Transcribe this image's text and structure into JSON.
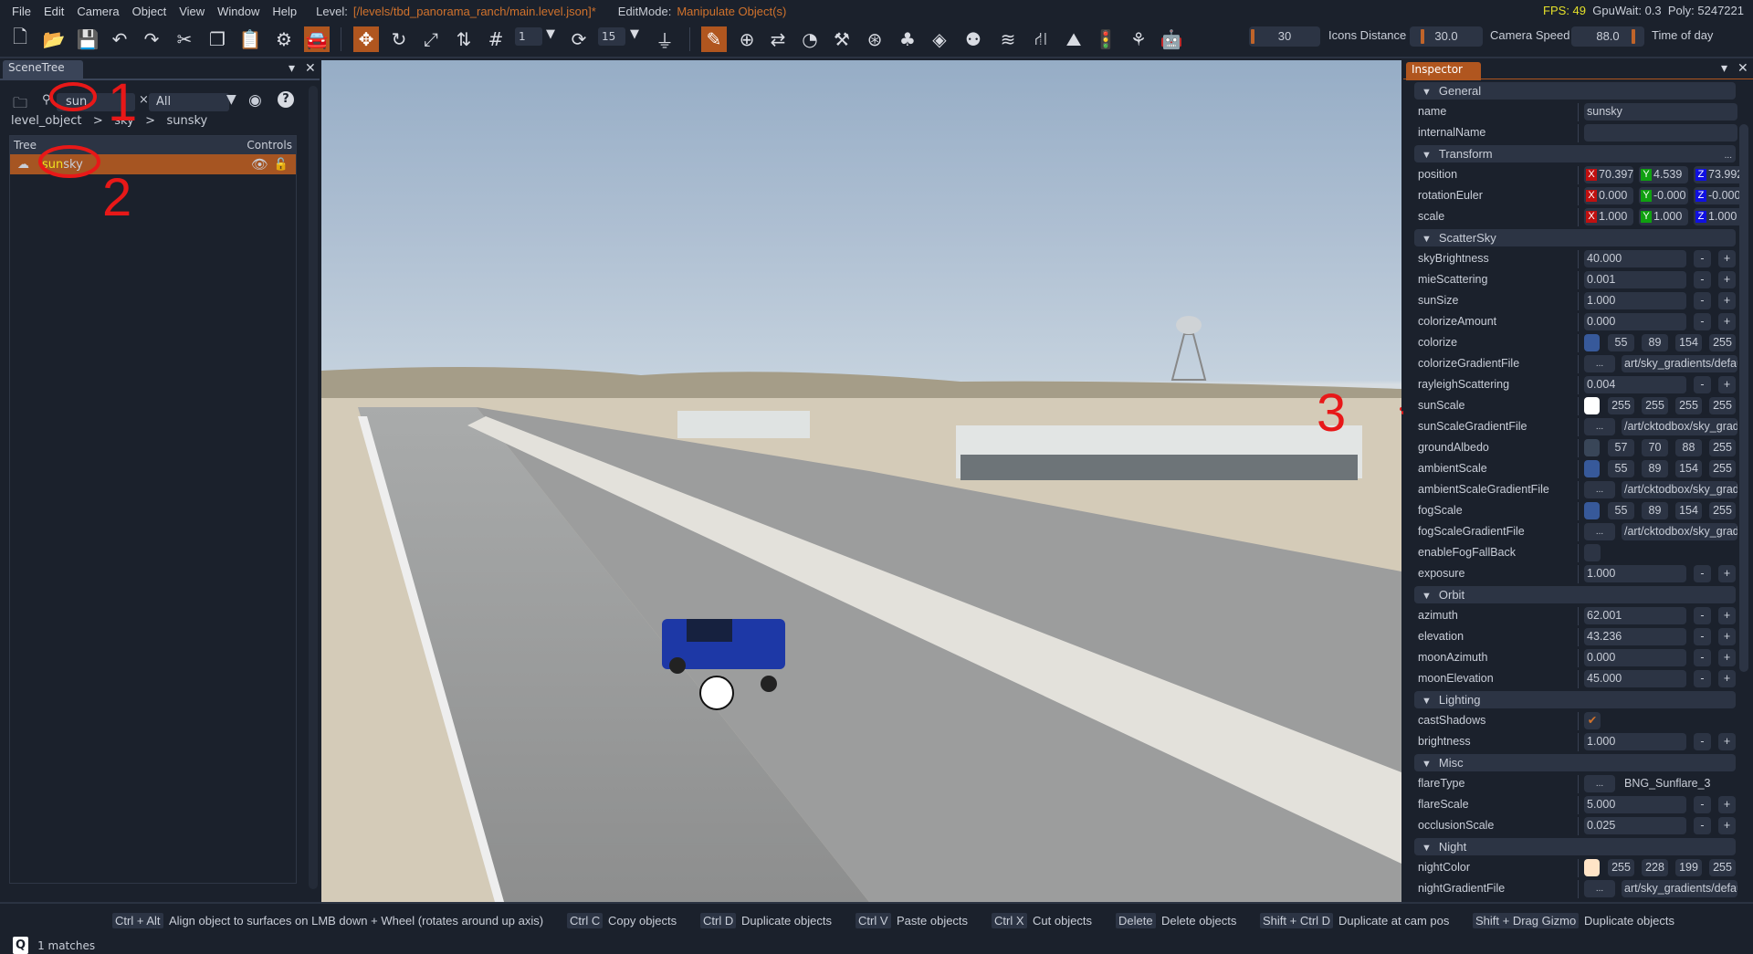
{
  "menu": {
    "items": [
      "File",
      "Edit",
      "Camera",
      "Object",
      "View",
      "Window",
      "Help"
    ],
    "level_label": "Level:",
    "level_value": "[/levels/tbd_panorama_ranch/main.level.json]*",
    "editmode_label": "EditMode:",
    "editmode_value": "Manipulate Object(s)"
  },
  "perf": {
    "fps": "FPS: 49",
    "gpu": "GpuWait: 0.3",
    "poly": "Poly: 5247221"
  },
  "toolbar": {
    "grid_value": "1",
    "rot_snap_value": "15",
    "icons_distance_value": "30",
    "icons_distance_label": "Icons Distance",
    "camera_speed_value": "30.0",
    "camera_speed_label": "Camera Speed",
    "time_of_day_value": "88.0",
    "time_of_day_label": "Time of day"
  },
  "scenetree": {
    "tab": "SceneTree",
    "search_value": "sun",
    "filter_value": "All",
    "breadcrumb": [
      "level_object",
      ">",
      "sky",
      ">",
      "sunsky"
    ],
    "col_tree": "Tree",
    "col_controls": "Controls",
    "item_match": "sun",
    "item_rest": "sky",
    "matches": "1 matches"
  },
  "inspector": {
    "tab": "Inspector",
    "rows": [
      {
        "t": "sec",
        "label": "General"
      },
      {
        "t": "text",
        "label": "name",
        "value": "sunsky"
      },
      {
        "t": "text",
        "label": "internalName",
        "value": ""
      },
      {
        "t": "sec",
        "label": "Transform",
        "extra": "..."
      },
      {
        "t": "vec3",
        "label": "position",
        "x": "70.397",
        "y": "4.539",
        "z": "73.992"
      },
      {
        "t": "vec3",
        "label": "rotationEuler",
        "x": "0.000",
        "y": "-0.000",
        "z": "-0.000"
      },
      {
        "t": "vec3",
        "label": "scale",
        "x": "1.000",
        "y": "1.000",
        "z": "1.000"
      },
      {
        "t": "sec",
        "label": "ScatterSky"
      },
      {
        "t": "num",
        "label": "skyBrightness",
        "value": "40.000"
      },
      {
        "t": "num",
        "label": "mieScattering",
        "value": "0.001"
      },
      {
        "t": "num",
        "label": "sunSize",
        "value": "1.000"
      },
      {
        "t": "num",
        "label": "colorizeAmount",
        "value": "0.000"
      },
      {
        "t": "color",
        "label": "colorize",
        "rgba": [
          "55",
          "89",
          "154",
          "255"
        ],
        "swatch": "#37599a"
      },
      {
        "t": "file",
        "label": "colorizeGradientFile",
        "value": "art/sky_gradients/default"
      },
      {
        "t": "num",
        "label": "rayleighScattering",
        "value": "0.004"
      },
      {
        "t": "color",
        "label": "sunScale",
        "rgba": [
          "255",
          "255",
          "255",
          "255"
        ],
        "swatch": "#ffffff"
      },
      {
        "t": "file",
        "label": "sunScaleGradientFile",
        "value": "/art/cktodbox/sky_gradients"
      },
      {
        "t": "color",
        "label": "groundAlbedo",
        "rgba": [
          "57",
          "70",
          "88",
          "255"
        ],
        "swatch": "#394658"
      },
      {
        "t": "color",
        "label": "ambientScale",
        "rgba": [
          "55",
          "89",
          "154",
          "255"
        ],
        "swatch": "#37599a"
      },
      {
        "t": "file",
        "label": "ambientScaleGradientFile",
        "value": "/art/cktodbox/sky_gradients"
      },
      {
        "t": "color",
        "label": "fogScale",
        "rgba": [
          "55",
          "89",
          "154",
          "255"
        ],
        "swatch": "#37599a"
      },
      {
        "t": "file",
        "label": "fogScaleGradientFile",
        "value": "/art/cktodbox/sky_gradients"
      },
      {
        "t": "check",
        "label": "enableFogFallBack",
        "checked": false
      },
      {
        "t": "num",
        "label": "exposure",
        "value": "1.000"
      },
      {
        "t": "sec",
        "label": "Orbit"
      },
      {
        "t": "num",
        "label": "azimuth",
        "value": "62.001"
      },
      {
        "t": "num",
        "label": "elevation",
        "value": "43.236"
      },
      {
        "t": "num",
        "label": "moonAzimuth",
        "value": "0.000"
      },
      {
        "t": "num",
        "label": "moonElevation",
        "value": "45.000"
      },
      {
        "t": "sec",
        "label": "Lighting"
      },
      {
        "t": "check",
        "label": "castShadows",
        "checked": true
      },
      {
        "t": "num",
        "label": "brightness",
        "value": "1.000"
      },
      {
        "t": "sec",
        "label": "Misc"
      },
      {
        "t": "plainfile",
        "label": "flareType",
        "value": "BNG_Sunflare_3"
      },
      {
        "t": "num",
        "label": "flareScale",
        "value": "5.000"
      },
      {
        "t": "num",
        "label": "occlusionScale",
        "value": "0.025"
      },
      {
        "t": "sec",
        "label": "Night"
      },
      {
        "t": "color",
        "label": "nightColor",
        "rgba": [
          "255",
          "228",
          "199",
          "255"
        ],
        "swatch": "#ffe4c7"
      },
      {
        "t": "file",
        "label": "nightGradientFile",
        "value": "art/sky_gradients/default"
      }
    ],
    "dots": "...",
    "minus": "-",
    "plus": "+",
    "x": "X",
    "y": "Y",
    "z": "Z"
  },
  "status": {
    "hints": [
      {
        "key": "Ctrl + Alt",
        "desc": "Align object to surfaces on LMB down + Wheel (rotates around up axis)"
      },
      {
        "key": "Ctrl C",
        "desc": "Copy objects"
      },
      {
        "key": "Ctrl D",
        "desc": "Duplicate objects"
      },
      {
        "key": "Ctrl V",
        "desc": "Paste objects"
      },
      {
        "key": "Ctrl X",
        "desc": "Cut objects"
      },
      {
        "key": "Delete",
        "desc": "Delete objects"
      },
      {
        "key": "Shift + Ctrl D",
        "desc": "Duplicate at cam pos"
      },
      {
        "key": "Shift + Drag Gizmo",
        "desc": "Duplicate objects"
      }
    ]
  },
  "annotations": {
    "one": "1",
    "two": "2",
    "three": "3"
  },
  "colors": {
    "accent": "#b0561f",
    "match": "#f1e21f",
    "axis_x": "#c01010",
    "axis_y": "#10a010",
    "axis_z": "#1010e0"
  }
}
